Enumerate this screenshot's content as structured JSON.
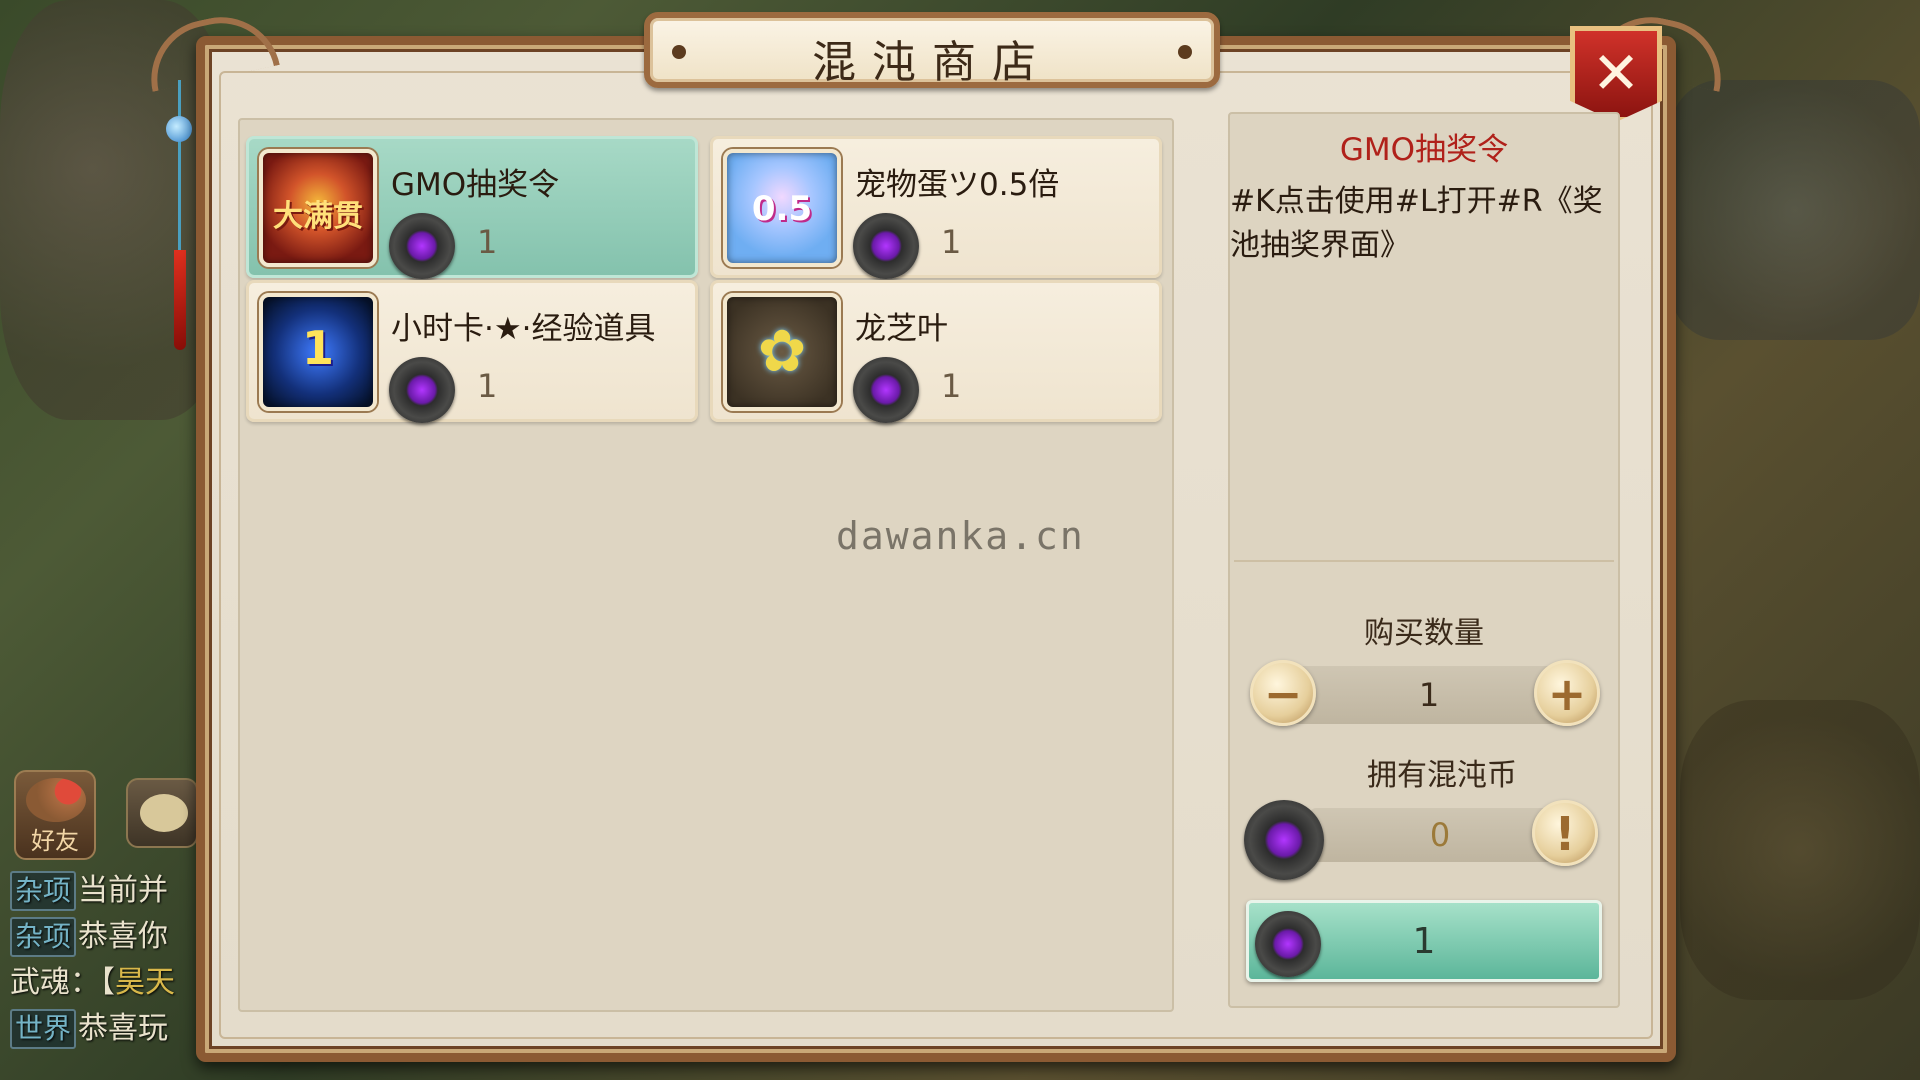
{
  "shop": {
    "title": "混沌商店"
  },
  "items": [
    {
      "name": "GMO抽奖令",
      "price": "1",
      "icon": "lucky-gift-icon",
      "glyph": "大满贯",
      "selected": true
    },
    {
      "name": "宠物蛋ツ0.5倍",
      "price": "1",
      "icon": "pet-egg-icon",
      "glyph": "0.5",
      "selected": false
    },
    {
      "name": "小时卡·★·经验道具",
      "price": "1",
      "icon": "hour-card-icon",
      "glyph": "1",
      "selected": false
    },
    {
      "name": "龙芝叶",
      "price": "1",
      "icon": "dragon-leaf-icon",
      "glyph": "✿",
      "selected": false
    }
  ],
  "detail": {
    "title": "GMO抽奖令",
    "description": "#K点击使用#L打开#R《奖池抽奖界面》",
    "quantity_label": "购买数量",
    "quantity": "1",
    "owned_label": "拥有混沌币",
    "owned": "0",
    "buy_cost": "1"
  },
  "watermark": "dawanka.cn",
  "friend_button": {
    "label": "好友"
  },
  "chat": [
    {
      "tag": "杂项",
      "text": "当前并"
    },
    {
      "tag": "杂项",
      "text": "恭喜你"
    },
    {
      "tag": "",
      "text": "武魂：【",
      "highlight": "昊天"
    },
    {
      "tag": "世界",
      "text": "恭喜玩"
    }
  ],
  "colors": {
    "selected_card": "#84c2ad",
    "detail_title": "#b0211a",
    "frame": "#8b5a33",
    "close_button": "#c0281e"
  }
}
